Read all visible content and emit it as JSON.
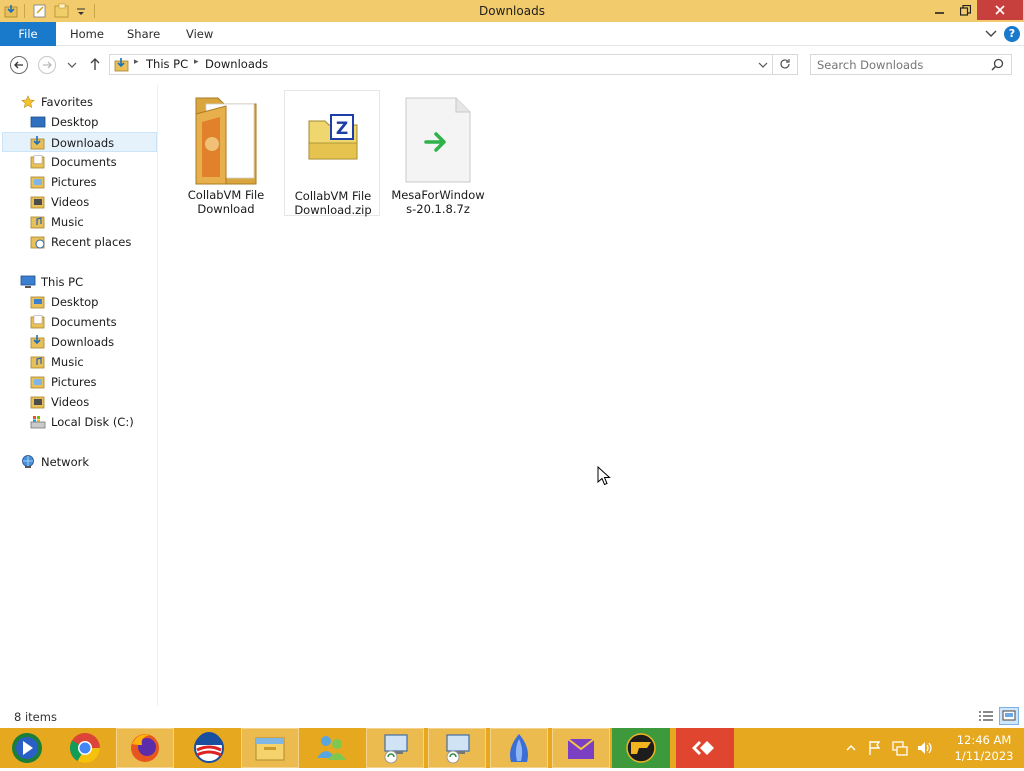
{
  "window": {
    "title": "Downloads"
  },
  "ribbon": {
    "file": "File",
    "home": "Home",
    "share": "Share",
    "view": "View"
  },
  "address": {
    "crumbs": [
      "This PC",
      "Downloads"
    ],
    "search_placeholder": "Search Downloads"
  },
  "navpane": {
    "favorites": {
      "label": "Favorites",
      "items": [
        "Desktop",
        "Downloads",
        "Documents",
        "Pictures",
        "Videos",
        "Music",
        "Recent places"
      ]
    },
    "thispc": {
      "label": "This PC",
      "items": [
        "Desktop",
        "Documents",
        "Downloads",
        "Music",
        "Pictures",
        "Videos",
        "Local Disk (C:)"
      ]
    },
    "network": {
      "label": "Network"
    },
    "selected": "Downloads"
  },
  "files": [
    {
      "name": "CollabVM File Download",
      "type": "folder-icon"
    },
    {
      "name": "CollabVM File Download.zip",
      "type": "zip-icon"
    },
    {
      "name": "MesaForWindows-20.1.8.7z",
      "type": "7z-icon"
    }
  ],
  "status": {
    "count": "8 items"
  },
  "taskbar": {
    "time": "12:46 AM",
    "date": "1/11/2023"
  },
  "colors": {
    "titlebar": "#f2cb6c",
    "taskbar": "#e6a81f",
    "file_tab": "#1979ca",
    "close": "#c8403d"
  }
}
